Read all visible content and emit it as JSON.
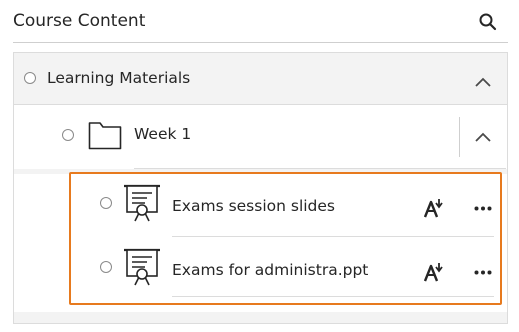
{
  "header": {
    "title": "Course Content",
    "search_icon": "search-icon"
  },
  "learning_materials": {
    "label": "Learning Materials",
    "expanded": true
  },
  "week": {
    "label": "Week 1",
    "icon": "folder-icon",
    "expanded": true
  },
  "items": [
    {
      "label": "Exams session slides",
      "icon": "presentation-icon",
      "action_icon": "ai-assist-icon",
      "menu_icon": "more-options-icon"
    },
    {
      "label": "Exams for administra.ppt",
      "icon": "presentation-icon",
      "action_icon": "ai-assist-icon",
      "menu_icon": "more-options-icon"
    }
  ],
  "colors": {
    "highlight_border": "#e77a1e",
    "panel_background": "#f3f3f3",
    "text": "#262626"
  }
}
